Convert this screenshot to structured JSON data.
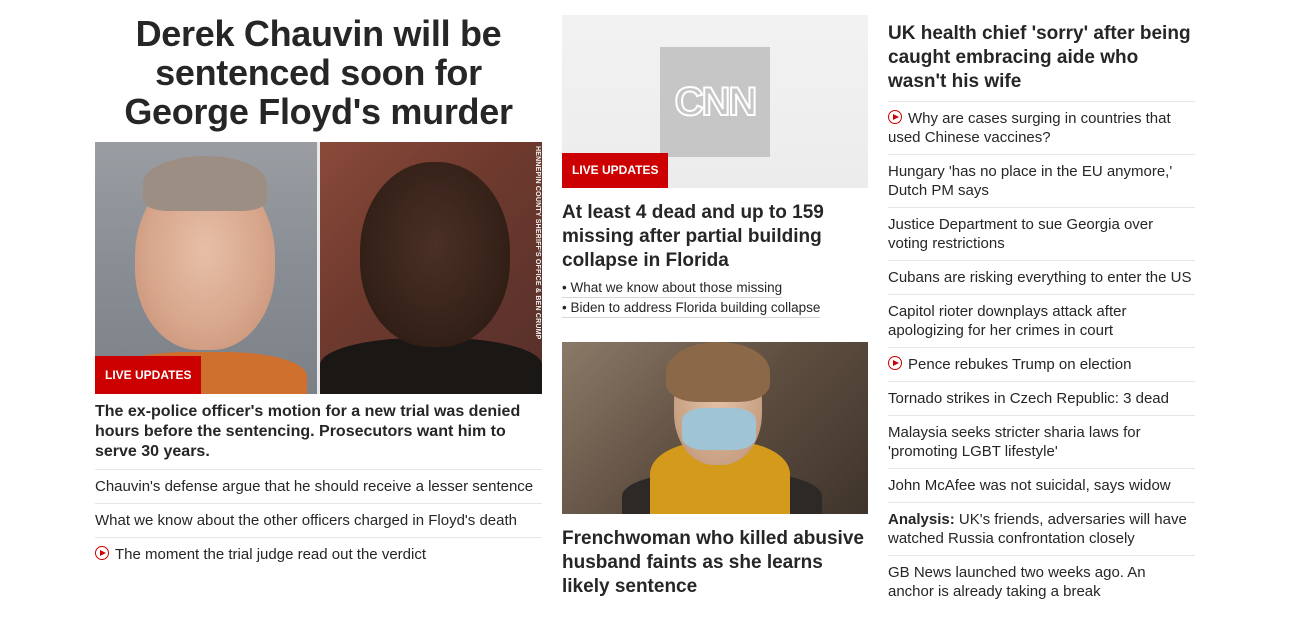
{
  "col1": {
    "headline": "Derek Chauvin will be sentenced soon for George Floyd's murder",
    "photo_credit": "HENNEPIN COUNTY SHERIFF'S OFFICE & BEN CRUMP",
    "badge": "LIVE UPDATES",
    "summary": "The ex-police officer's motion for a new trial was denied hours before the sentencing. Prosecutors want him to serve 30 years.",
    "links": [
      {
        "text": "Chauvin's defense argue that he should receive a lesser sentence",
        "video": false
      },
      {
        "text": "What we know about the other officers charged in Floyd's death",
        "video": false
      },
      {
        "text": "The moment the trial judge read out the verdict",
        "video": true
      }
    ]
  },
  "col2": {
    "logo_text": "CNN",
    "badge": "LIVE UPDATES",
    "story1": {
      "headline": "At least 4 dead and up to 159 missing after partial building collapse in Florida",
      "bullets": [
        "• What we know about those missing",
        "• Biden to address Florida building collapse"
      ]
    },
    "story2": {
      "headline": "Frenchwoman who killed abusive husband faints as she learns likely sentence"
    }
  },
  "col3": {
    "headline": "UK health chief 'sorry' after being caught embracing aide who wasn't his wife",
    "links": [
      {
        "text": "Why are cases surging in countries that used Chinese vaccines?",
        "video": true
      },
      {
        "text": "Hungary 'has no place in the EU anymore,' Dutch PM says",
        "video": false
      },
      {
        "text": "Justice Department to sue Georgia over voting restrictions",
        "video": false
      },
      {
        "text": "Cubans are risking everything to enter the US",
        "video": false
      },
      {
        "text": "Capitol rioter downplays attack after apologizing for her crimes in court",
        "video": false
      },
      {
        "text": "Pence rebukes Trump on election",
        "video": true
      },
      {
        "text": "Tornado strikes in Czech Republic: 3 dead",
        "video": false
      },
      {
        "text": "Malaysia seeks stricter sharia laws for 'promoting LGBT lifestyle'",
        "video": false
      },
      {
        "text": "John McAfee was not suicidal, says widow",
        "video": false
      },
      {
        "label": "Analysis:",
        "text": " UK's friends, adversaries will have watched Russia confrontation closely",
        "video": false
      },
      {
        "text": "GB News launched two weeks ago. An anchor is already taking a break",
        "video": false
      }
    ]
  },
  "colors": {
    "accent_red": "#cc0000",
    "text": "#262626",
    "divider": "#e6e6e6"
  },
  "icons": {
    "video": "play-circle-icon"
  }
}
